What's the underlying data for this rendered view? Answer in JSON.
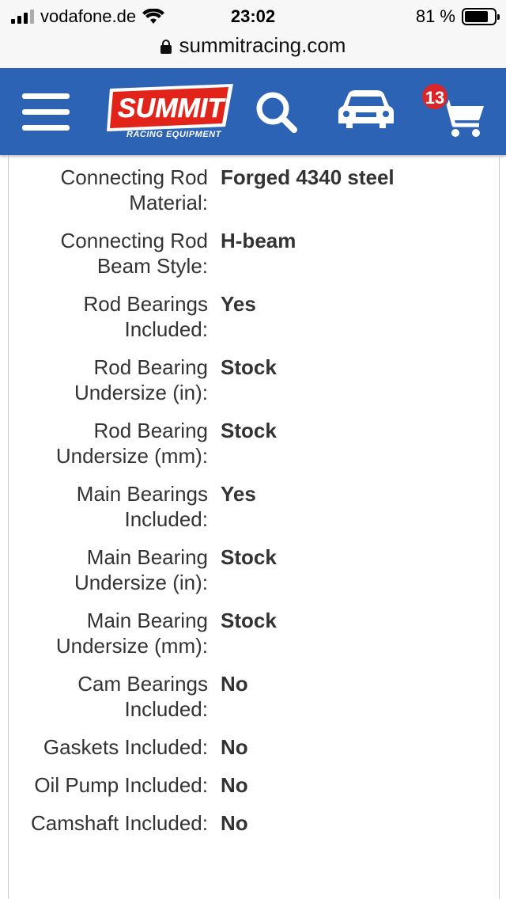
{
  "status_bar": {
    "carrier": "vodafone.de",
    "time": "23:02",
    "battery_percent": "81 %"
  },
  "browser": {
    "url": "summitracing.com"
  },
  "header": {
    "logo_text": "SUMMIT",
    "logo_subtext": "RACING EQUIPMENT",
    "cart_count": "13",
    "brand_color": "#2d63b4",
    "logo_color": "#e2231a",
    "badge_color": "#d9262a"
  },
  "specs": [
    {
      "label": "Connecting Rod Material:",
      "value": "Forged 4340 steel"
    },
    {
      "label": "Connecting Rod Beam Style:",
      "value": "H-beam"
    },
    {
      "label": "Rod Bearings Included:",
      "value": "Yes"
    },
    {
      "label": "Rod Bearing Undersize (in):",
      "value": "Stock"
    },
    {
      "label": "Rod Bearing Undersize (mm):",
      "value": "Stock"
    },
    {
      "label": "Main Bearings Included:",
      "value": "Yes"
    },
    {
      "label": "Main Bearing Undersize (in):",
      "value": "Stock"
    },
    {
      "label": "Main Bearing Undersize (mm):",
      "value": "Stock"
    },
    {
      "label": "Cam Bearings Included:",
      "value": "No"
    },
    {
      "label": "Gaskets Included:",
      "value": "No"
    },
    {
      "label": "Oil Pump Included:",
      "value": "No"
    },
    {
      "label": "Camshaft Included:",
      "value": "No"
    }
  ]
}
